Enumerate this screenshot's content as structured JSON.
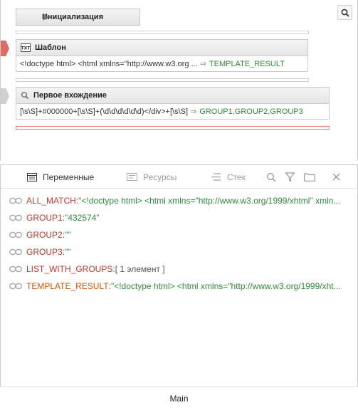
{
  "search": {
    "icon": "search-icon"
  },
  "init_block": {
    "label": "Инициализация"
  },
  "template_block": {
    "title": "Шаблон",
    "icon": "text-icon",
    "value": "<!doctype html> <html xmlns=\"http://www.w3.org ...",
    "arrow": "⇒",
    "result": "TEMPLATE_RESULT"
  },
  "match_block": {
    "title": "Первое вхождение",
    "icon": "search-icon",
    "value": "[\\s\\S]+#000000+[\\s\\S]+(\\d\\d\\d\\d\\d\\d)</div>+[\\s\\S]",
    "arrow": "⇒",
    "result": "GROUP1,GROUP2,GROUP3"
  },
  "tabs": [
    {
      "label": "Переменные",
      "icon": "variables-icon"
    },
    {
      "label": "Ресурсы",
      "icon": "resources-icon"
    },
    {
      "label": "Стек",
      "icon": "stack-icon"
    }
  ],
  "toolbar_icons": [
    "search-icon",
    "filter-icon",
    "folder-icon",
    "close-icon"
  ],
  "variables": [
    {
      "name": "ALL_MATCH",
      "sep": ": ",
      "value": "\"<!doctype html> <html xmlns=\"http://www.w3.org/1999/xhtml\" xmln..."
    },
    {
      "name": "GROUP1",
      "sep": ": ",
      "value": "\"432574\""
    },
    {
      "name": "GROUP2",
      "sep": ": ",
      "value": "\"\""
    },
    {
      "name": "GROUP3",
      "sep": ": ",
      "value": "\"\""
    },
    {
      "name": "LIST_WITH_GROUPS",
      "sep": ": ",
      "value": "[  1 элемент  ]"
    },
    {
      "name": "TEMPLATE_RESULT",
      "sep": ": ",
      "value": "\"<!doctype html> <html xmlns=\"http://www.w3.org/1999/xht..."
    }
  ],
  "footer": {
    "label": "Main"
  },
  "colors": {
    "var_name": "#c0392b",
    "var_value": "#2e8b3a",
    "error_marker": "#e06b63"
  }
}
